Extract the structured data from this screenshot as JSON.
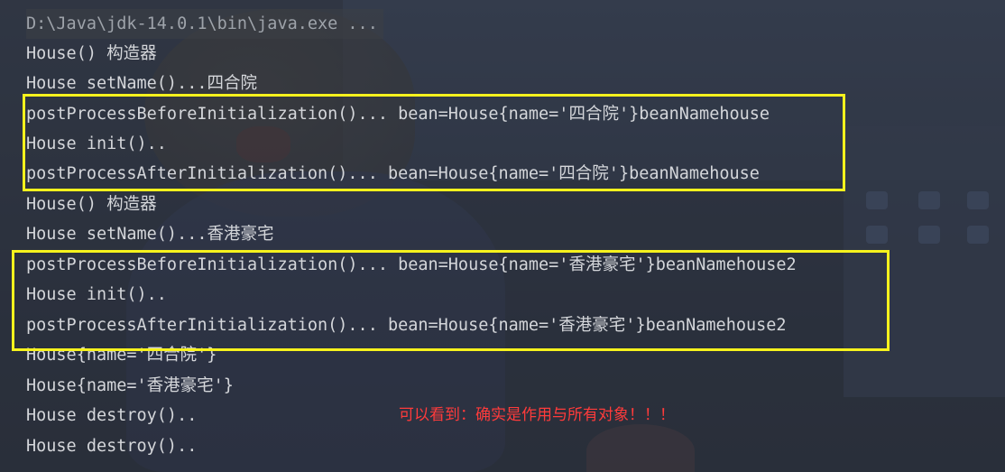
{
  "console": {
    "command": "D:\\Java\\jdk-14.0.1\\bin\\java.exe ...",
    "lines": [
      "House() 构造器",
      "House setName()...四合院",
      "postProcessBeforeInitialization()... bean=House{name='四合院'}beanNamehouse",
      "House init()..",
      "postProcessAfterInitialization()... bean=House{name='四合院'}beanNamehouse",
      "House() 构造器",
      "House setName()...香港豪宅",
      "postProcessBeforeInitialization()... bean=House{name='香港豪宅'}beanNamehouse2",
      "House init()..",
      "postProcessAfterInitialization()... bean=House{name='香港豪宅'}beanNamehouse2",
      "House{name='四合院'}",
      "House{name='香港豪宅'}",
      "House destroy()..",
      "House destroy().."
    ]
  },
  "annotation": {
    "text": "可以看到：确实是作用与所有对象！！！",
    "color": "#ff3b3b"
  },
  "colors": {
    "highlight_border": "#f6f21d",
    "console_text": "#d4d6da",
    "command_text": "#9ea3aa"
  }
}
